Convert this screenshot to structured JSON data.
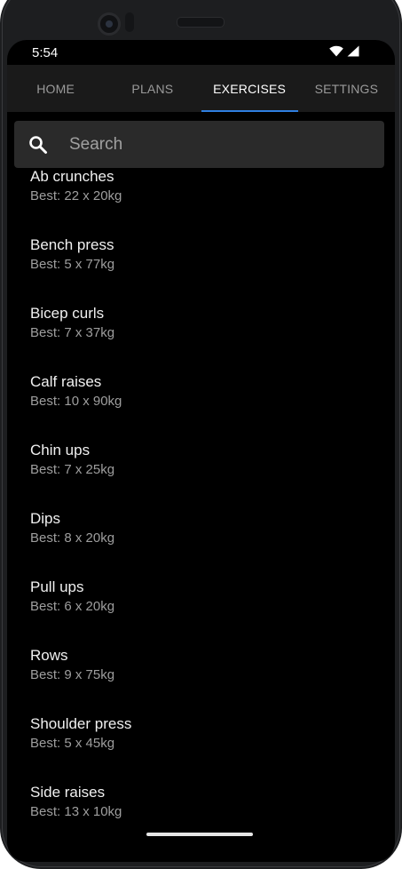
{
  "status_bar": {
    "time": "5:54",
    "wifi_icon": "wifi-icon",
    "signal_icon": "cell-signal-icon"
  },
  "tabs": [
    {
      "label": "HOME",
      "active": false
    },
    {
      "label": "PLANS",
      "active": false
    },
    {
      "label": "EXERCISES",
      "active": true
    },
    {
      "label": "SETTINGS",
      "active": false
    }
  ],
  "search": {
    "icon": "search-icon",
    "placeholder": "Search",
    "value": ""
  },
  "exercises": [
    {
      "name": "Ab crunches",
      "best": "Best: 22 x 20kg"
    },
    {
      "name": "Bench press",
      "best": "Best: 5 x 77kg"
    },
    {
      "name": "Bicep curls",
      "best": "Best: 7 x 37kg"
    },
    {
      "name": "Calf raises",
      "best": "Best: 10 x 90kg"
    },
    {
      "name": "Chin ups",
      "best": "Best: 7 x 25kg"
    },
    {
      "name": "Dips",
      "best": "Best: 8 x 20kg"
    },
    {
      "name": "Pull ups",
      "best": "Best: 6 x 20kg"
    },
    {
      "name": "Rows",
      "best": "Best: 9 x 75kg"
    },
    {
      "name": "Shoulder press",
      "best": "Best: 5 x 45kg"
    },
    {
      "name": "Side raises",
      "best": "Best: 13 x 10kg"
    }
  ],
  "colors": {
    "background": "#000000",
    "tab_bar": "#1a1a1a",
    "accent": "#2f7fe0",
    "search_field": "#2a2a2a",
    "primary_text": "#f0f0f0",
    "secondary_text": "#9e9e9e"
  }
}
